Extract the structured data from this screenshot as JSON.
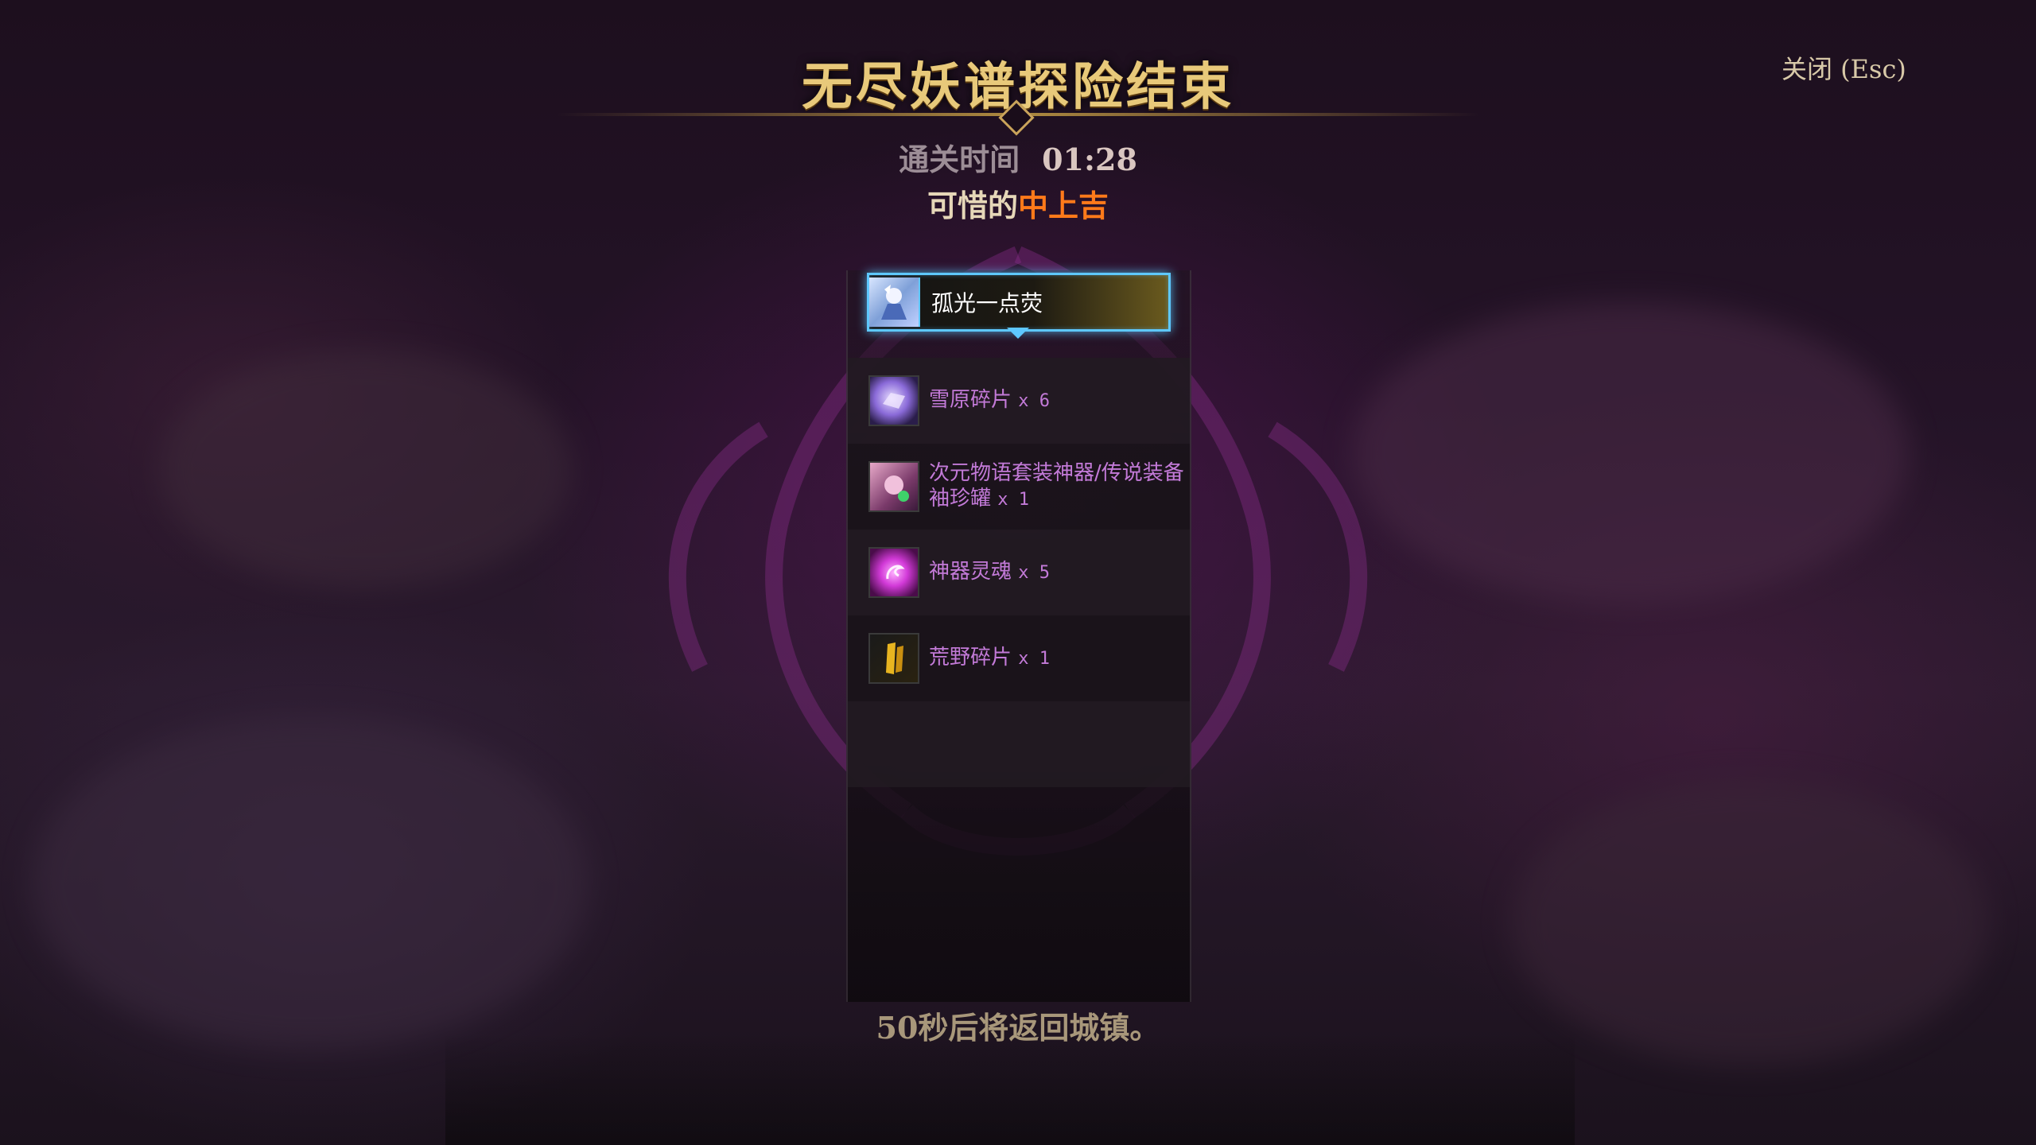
{
  "header": {
    "title": "无尽妖谱探险结束",
    "close_label": "关闭 (Esc)"
  },
  "summary": {
    "time_label": "通关时间",
    "time_value": "01:28",
    "result_prefix": "可惜的",
    "result_grade": "中上吉"
  },
  "rewards": {
    "header_item": {
      "name": "孤光一点荧",
      "icon": "character-portrait-icon"
    },
    "items": [
      {
        "name": "雪原碎片",
        "qty": "x 6",
        "icon": "snowfield-shard-icon",
        "color": "#c37ad8"
      },
      {
        "name": "次元物语套装神器/传说装备袖珍罐",
        "qty": "x 1",
        "icon": "pocket-jar-icon",
        "color": "#c37ad8"
      },
      {
        "name": "神器灵魂",
        "qty": "x 5",
        "icon": "artifact-soul-icon",
        "color": "#c37ad8"
      },
      {
        "name": "荒野碎片",
        "qty": "x 1",
        "icon": "wilderness-shard-icon",
        "color": "#c37ad8"
      }
    ]
  },
  "footer": {
    "countdown": "50秒后将返回城镇。"
  },
  "colors": {
    "title_gold": "#e8c97a",
    "grade_orange": "#ff7a1a",
    "highlight_blue": "#5ec8ff",
    "item_purple": "#c37ad8"
  }
}
